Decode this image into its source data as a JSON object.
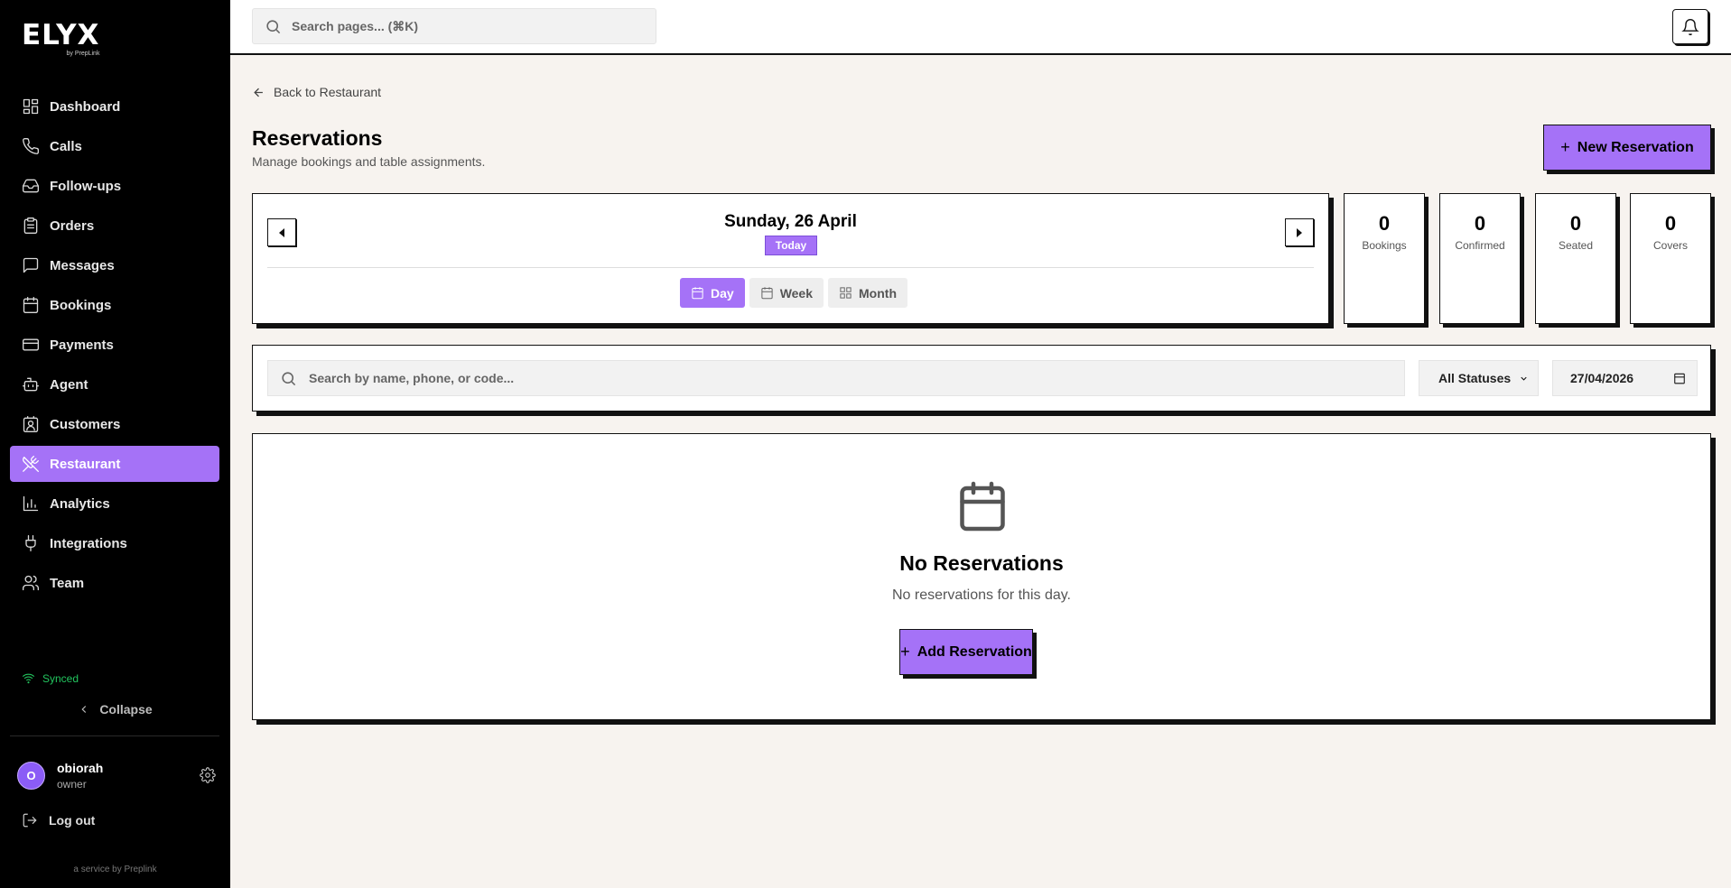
{
  "brand": {
    "logo": "ELYX",
    "tagline": "by PrepLink"
  },
  "sidebar": {
    "items": [
      {
        "label": "Dashboard",
        "icon": "dashboard-icon"
      },
      {
        "label": "Calls",
        "icon": "phone-icon"
      },
      {
        "label": "Follow-ups",
        "icon": "inbox-icon"
      },
      {
        "label": "Orders",
        "icon": "clipboard-icon"
      },
      {
        "label": "Messages",
        "icon": "message-icon"
      },
      {
        "label": "Bookings",
        "icon": "calendar-icon"
      },
      {
        "label": "Payments",
        "icon": "credit-card-icon"
      },
      {
        "label": "Agent",
        "icon": "bot-icon"
      },
      {
        "label": "Customers",
        "icon": "contact-icon"
      },
      {
        "label": "Restaurant",
        "icon": "utensils-icon",
        "active": true
      },
      {
        "label": "Analytics",
        "icon": "bar-chart-icon"
      },
      {
        "label": "Integrations",
        "icon": "plug-icon"
      },
      {
        "label": "Team",
        "icon": "users-icon"
      }
    ],
    "sync_status": "Synced",
    "collapse_label": "Collapse",
    "user": {
      "initial": "O",
      "name": "obiorah",
      "role": "owner"
    },
    "logout_label": "Log out",
    "service_note": "a service by Preplink"
  },
  "topbar": {
    "search_placeholder": "Search pages... (⌘K)"
  },
  "main": {
    "back_label": "Back to Restaurant",
    "title": "Reservations",
    "subtitle": "Manage bookings and table assignments.",
    "new_button": "New Reservation",
    "date_nav": {
      "date": "Sunday, 26 April",
      "badge": "Today",
      "views": [
        {
          "label": "Day",
          "active": true
        },
        {
          "label": "Week"
        },
        {
          "label": "Month"
        }
      ]
    },
    "stats": [
      {
        "value": "0",
        "label": "Bookings"
      },
      {
        "value": "0",
        "label": "Confirmed"
      },
      {
        "value": "0",
        "label": "Seated"
      },
      {
        "value": "0",
        "label": "Covers"
      }
    ],
    "filters": {
      "search_placeholder": "Search by name, phone, or code...",
      "status": "All Statuses",
      "date": "27/04/2026"
    },
    "empty": {
      "title": "No Reservations",
      "subtitle": "No reservations for this day.",
      "button": "Add Reservation"
    }
  },
  "colors": {
    "accent": "#a572f7",
    "sidebar_bg": "#000000",
    "page_bg": "#f7f3ef",
    "synced": "#22c55e"
  }
}
